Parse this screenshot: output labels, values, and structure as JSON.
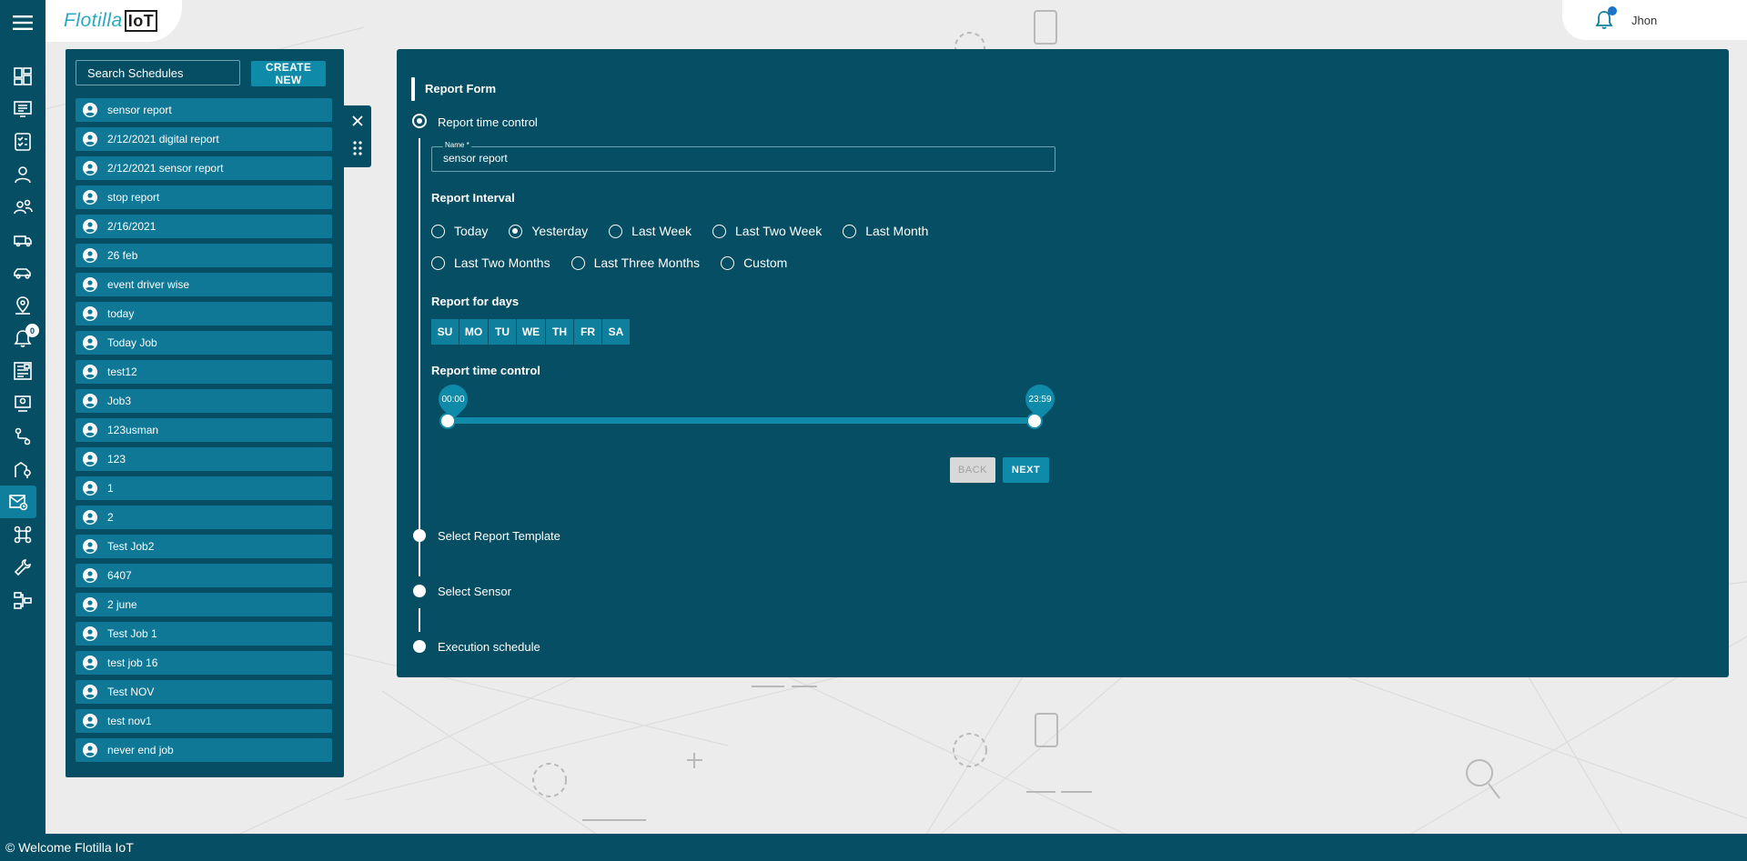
{
  "app": {
    "logo_text": "Flotilla",
    "logo_badge": "IoT",
    "user_name": "Jhon",
    "footer_text": "© Welcome Flotilla IoT"
  },
  "sidebar": {
    "notification_count": "0",
    "items": [
      {
        "icon": "dashboard-icon"
      },
      {
        "icon": "monitor-list-icon"
      },
      {
        "icon": "checklist-icon"
      },
      {
        "icon": "user-icon"
      },
      {
        "icon": "users-route-icon"
      },
      {
        "icon": "truck-icon"
      },
      {
        "icon": "car-icon"
      },
      {
        "icon": "location-user-icon"
      },
      {
        "icon": "bell-icon"
      },
      {
        "icon": "report-icon"
      },
      {
        "icon": "user-settings-icon"
      },
      {
        "icon": "route-icon"
      },
      {
        "icon": "geofence-icon"
      },
      {
        "icon": "scheduled-report-icon"
      },
      {
        "icon": "command-icon"
      },
      {
        "icon": "wrench-icon"
      },
      {
        "icon": "workflow-icon"
      }
    ]
  },
  "schedules": {
    "search_placeholder": "Search Schedules",
    "create_label": "CREATE NEW",
    "items": [
      "sensor report",
      "2/12/2021 digital report",
      "2/12/2021 sensor report",
      "stop report",
      "2/16/2021",
      "26 feb",
      "event driver wise",
      "today",
      "Today Job",
      "test12",
      "Job3",
      "123usman",
      "123",
      "1",
      "2",
      "Test Job2",
      "6407",
      "2 june",
      "Test Job 1",
      "test job 16",
      "Test NOV",
      "test nov1",
      "never end job"
    ]
  },
  "form": {
    "title": "Report Form",
    "steps": [
      "Report time control",
      "Select Report Template",
      "Select Sensor",
      "Execution schedule"
    ],
    "name_label": "Name *",
    "name_value": "sensor report",
    "interval_title": "Report Interval",
    "interval_options": [
      "Today",
      "Yesterday",
      "Last Week",
      "Last Two Week",
      "Last Month",
      "Last Two Months",
      "Last Three Months",
      "Custom"
    ],
    "interval_selected": "Yesterday",
    "days_title": "Report for days",
    "days": [
      "SU",
      "MO",
      "TU",
      "WE",
      "TH",
      "FR",
      "SA"
    ],
    "time_title": "Report time control",
    "time_start": "00:00",
    "time_end": "23:59",
    "back_label": "BACK",
    "next_label": "NEXT"
  },
  "colors": {
    "panel": "#054e63",
    "accent": "#0f8aa8",
    "list_item": "#0e7896",
    "background": "#ececec"
  }
}
